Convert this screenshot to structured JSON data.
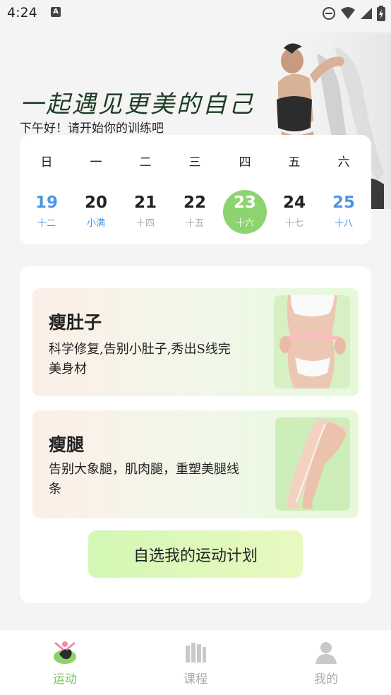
{
  "status_bar": {
    "time": "4:24",
    "a_badge": "A"
  },
  "hero": {
    "slogan": "一起遇见更美的自己",
    "greeting": "下午好！请开始你的训练吧"
  },
  "calendar": {
    "weekdays": [
      "日",
      "一",
      "二",
      "三",
      "四",
      "五",
      "六"
    ],
    "days": [
      {
        "num": "19",
        "lunar": "十二"
      },
      {
        "num": "20",
        "lunar": "小满"
      },
      {
        "num": "21",
        "lunar": "十四"
      },
      {
        "num": "22",
        "lunar": "十五"
      },
      {
        "num": "23",
        "lunar": "十六"
      },
      {
        "num": "24",
        "lunar": "十七"
      },
      {
        "num": "25",
        "lunar": "十八"
      }
    ],
    "selected_index": 4
  },
  "plans": [
    {
      "title": "瘦肚子",
      "desc": "科学修复,告别小肚子,秀出S线完美身材"
    },
    {
      "title": "瘦腿",
      "desc": "告别大象腿，肌肉腿，重塑美腿线条"
    }
  ],
  "cta_label": "自选我的运动计划",
  "tabs": [
    {
      "label": "运动",
      "active": true
    },
    {
      "label": "课程",
      "active": false
    },
    {
      "label": "我的",
      "active": false
    }
  ],
  "colors": {
    "accent_green": "#8dd36f",
    "active_tab": "#7cc35e",
    "weekend_blue": "#4a97e8"
  }
}
